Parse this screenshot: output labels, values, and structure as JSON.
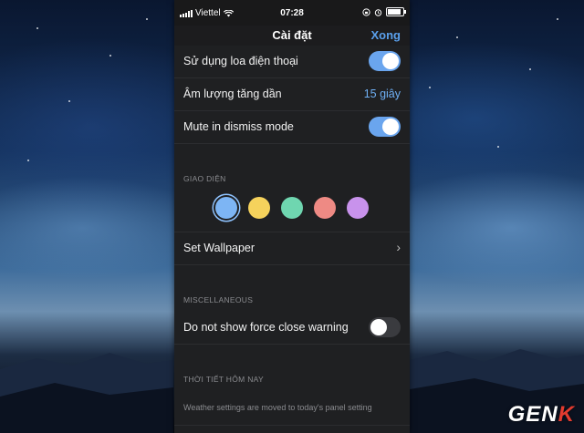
{
  "status_bar": {
    "carrier": "Viettel",
    "time": "07:28"
  },
  "nav": {
    "title": "Cài đặt",
    "done_label": "Xong"
  },
  "settings_rows": {
    "speaker": {
      "label": "Sử dụng loa điện thoại",
      "toggle": "on"
    },
    "volume": {
      "label": "Âm lượng tăng dần",
      "value": "15 giây"
    },
    "mute": {
      "label": "Mute in dismiss mode",
      "toggle": "on"
    }
  },
  "appearance": {
    "header": "GIAO DIỆN",
    "colors": [
      "#7db5f4",
      "#f5d25c",
      "#6fd6b0",
      "#ee8a84",
      "#c892ec"
    ],
    "selected_color_index": 0,
    "wallpaper_label": "Set Wallpaper"
  },
  "misc": {
    "header": "MISCELLANEOUS",
    "force_close_label": "Do not show force close warning",
    "force_close_toggle": "off"
  },
  "weather": {
    "header": "THỜI TIẾT HÔM NAY",
    "note": "Weather settings are moved to today's panel setting"
  },
  "watermark": {
    "text": "GEN",
    "accent": "K"
  },
  "colors": {
    "accent_blue": "#5aa0ec",
    "value_blue": "#6fb0f5",
    "panel_bg": "#1f2022"
  }
}
